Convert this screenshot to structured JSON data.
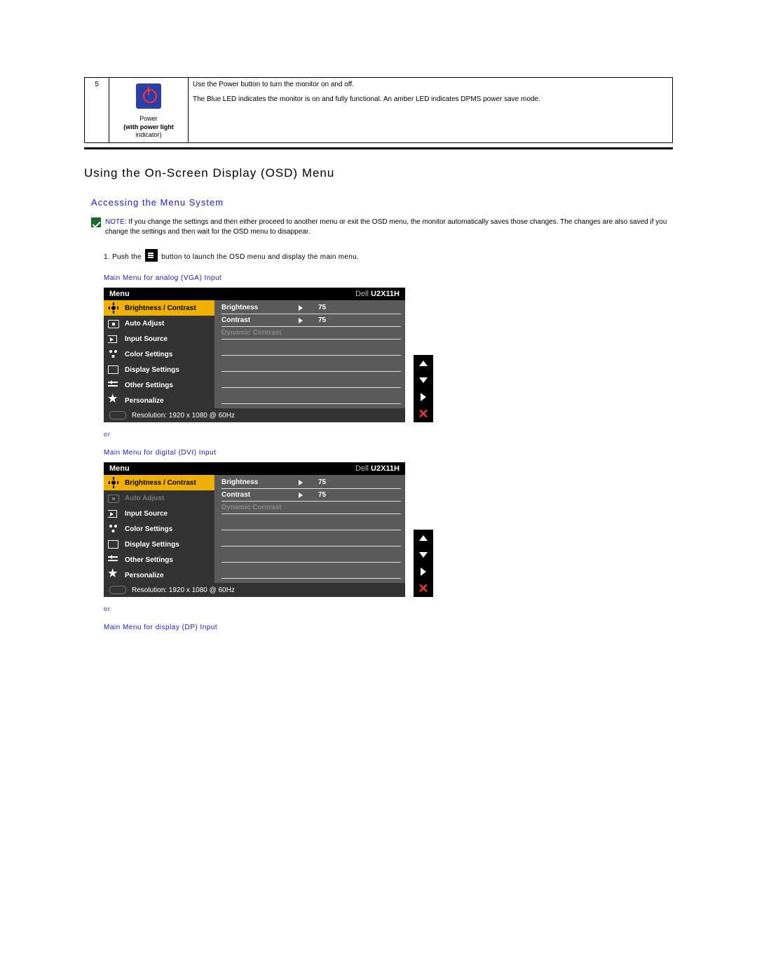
{
  "table_row": {
    "index": "5",
    "icon_label_line1": "Power",
    "icon_label_line2": "(with power light",
    "icon_label_line3": "indicator)",
    "desc_line1": "Use the Power button to turn the monitor on and off.",
    "desc_line2": "The Blue LED indicates the monitor is on and fully functional. An amber LED indicates DPMS power save mode."
  },
  "heading": "Using the On-Screen Display (OSD) Menu",
  "subheading": "Accessing the Menu System",
  "note": {
    "label": "NOTE:",
    "text": "If you change the settings and then either proceed to another menu or exit the OSD menu, the monitor automatically saves those changes. The changes are also saved if you change the settings and then wait for the OSD menu to disappear."
  },
  "step1_pre": "1. Push the",
  "step1_post": "button to launch the OSD menu and display the main menu.",
  "label_vga": "Main Menu for analog (VGA) Input",
  "or_label": "or",
  "label_dvi": "Main Menu for digital (DVI) Input",
  "label_dp": "Main Menu for display (DP) Input",
  "osd": {
    "title": "Menu",
    "brand": "Dell",
    "model": "U2X11H",
    "nav": {
      "brightness": "Brightness / Contrast",
      "auto": "Auto Adjust",
      "input": "Input Source",
      "color": "Color Settings",
      "display": "Display Settings",
      "other": "Other Settings",
      "personalize": "Personalize"
    },
    "opts": {
      "brightness": {
        "name": "Brightness",
        "value": "75"
      },
      "contrast": {
        "name": "Contrast",
        "value": "75"
      },
      "dynamic": "Dynamic Contrast"
    },
    "footer": "Resolution: 1920 x 1080 @ 60Hz"
  }
}
